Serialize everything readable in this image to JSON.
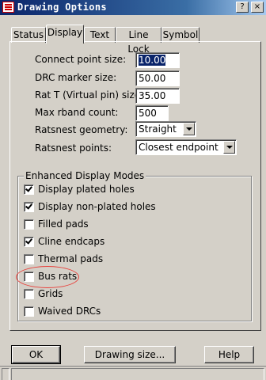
{
  "window": {
    "title": "Drawing Options",
    "controls": {
      "help": "?",
      "close": "×"
    }
  },
  "tabs": [
    {
      "label": "Status",
      "active": false
    },
    {
      "label": "Display",
      "active": true
    },
    {
      "label": "Text",
      "active": false
    },
    {
      "label": "Line Lock",
      "active": false
    },
    {
      "label": "Symbol",
      "active": false
    }
  ],
  "display": {
    "connect_point_size": {
      "label": "Connect point size:",
      "value": "10.00"
    },
    "drc_marker_size": {
      "label": "DRC marker size:",
      "value": "50.00"
    },
    "rat_t_size": {
      "label": "Rat T (Virtual pin) size:",
      "value": "35.00"
    },
    "max_rband_count": {
      "label": "Max rband count:",
      "value": "500"
    },
    "ratsnest_geometry": {
      "label": "Ratsnest geometry:",
      "value": "Straight"
    },
    "ratsnest_points": {
      "label": "Ratsnest points:",
      "value": "Closest endpoint"
    }
  },
  "enhanced": {
    "title": "Enhanced Display Modes",
    "items": [
      {
        "label": "Display plated holes",
        "checked": true
      },
      {
        "label": "Display non-plated holes",
        "checked": true
      },
      {
        "label": "Filled pads",
        "checked": false
      },
      {
        "label": "Cline endcaps",
        "checked": true
      },
      {
        "label": "Thermal pads",
        "checked": false
      },
      {
        "label": "Bus rats",
        "checked": false
      },
      {
        "label": "Grids",
        "checked": false
      },
      {
        "label": "Waived DRCs",
        "checked": false
      }
    ]
  },
  "buttons": {
    "ok": "OK",
    "drawing_size": "Drawing size...",
    "help": "Help"
  },
  "colors": {
    "title_bar": "#0a246a",
    "annotation": "#e8413c",
    "face": "#d4d0c8"
  }
}
